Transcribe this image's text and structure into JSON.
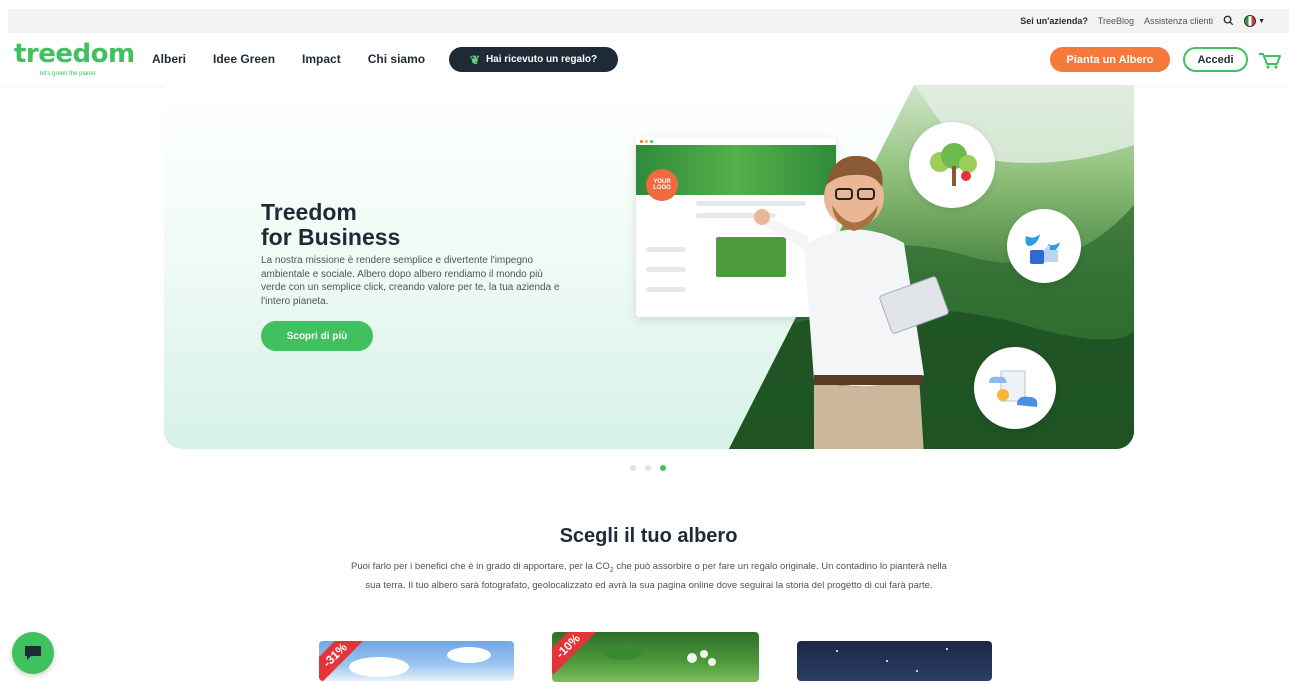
{
  "topbar": {
    "business_label": "Sei un'azienda?",
    "treeblog": "TreeBlog",
    "support": "Assistenza clienti",
    "search_icon": "search-icon",
    "flag_icon": "italy-flag-icon"
  },
  "nav": {
    "logo_word": "treedom",
    "logo_tagline": "let's green the planet",
    "menu": [
      "Alberi",
      "Idee Green",
      "Impact",
      "Chi siamo"
    ],
    "gift_label": "Hai ricevuto un regalo?",
    "plant_label": "Pianta un Albero",
    "login_label": "Accedi",
    "cart_icon": "cart-icon"
  },
  "hero": {
    "title_line1": "Treedom",
    "title_line2": "for Business",
    "text": "La nostra missione è rendere semplice e divertente l'impegno ambientale e sociale. Albero dopo albero rendiamo il mondo più verde con un semplice click, creando valore per te, la tua azienda e l'intero pianeta.",
    "cta": "Scopri di più",
    "mock_logo": "YOUR LOGO",
    "slides": 3,
    "active_slide": 3
  },
  "section": {
    "title": "Scegli il tuo albero",
    "text_part1": "Puoi farlo per i benefici che è in grado di apportare, per la CO",
    "text_sub": "2",
    "text_part2": " che può assorbire o per fare un regalo originale. Un contadino lo pianterà nella sua terra. Il tuo albero sarà fotografato, geolocalizzato ed avrà la sua pagina online dove seguirai la storia del progetto di cui farà parte."
  },
  "cards": [
    {
      "badge": "-31%"
    },
    {
      "badge": "-10%"
    },
    {
      "badge": ""
    }
  ],
  "colors": {
    "brand_green": "#3ec15e",
    "dark": "#1e2b36",
    "orange": "#f5793a",
    "discount_red": "#e2343a"
  }
}
